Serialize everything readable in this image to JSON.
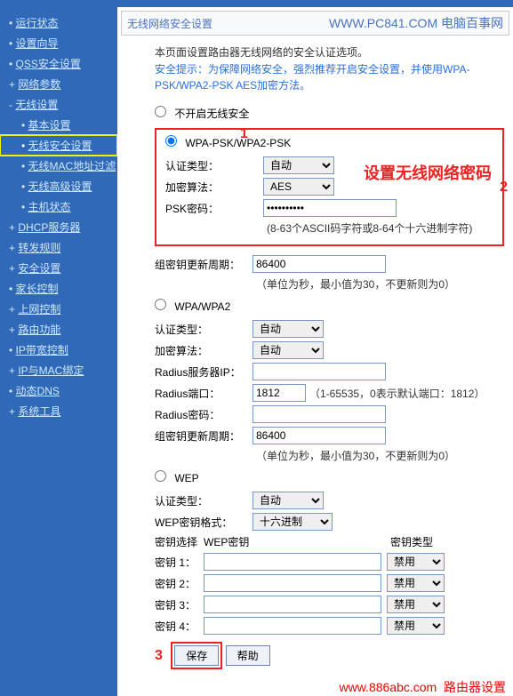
{
  "header": {
    "title": "无线网络安全设置",
    "brand": "WWW.PC841.COM 电脑百事网"
  },
  "sidebar": {
    "items": [
      "运行状态",
      "设置向导",
      "QSS安全设置",
      "网络参数",
      "无线设置"
    ],
    "wireless_sub": [
      "基本设置",
      "无线安全设置",
      "无线MAC地址过滤",
      "无线高级设置",
      "主机状态"
    ],
    "items2": [
      "DHCP服务器",
      "转发规则",
      "安全设置",
      "家长控制",
      "上网控制",
      "路由功能",
      "IP带宽控制",
      "IP与MAC绑定",
      "动态DNS",
      "系统工具"
    ]
  },
  "content": {
    "intro": "本页面设置路由器无线网络的安全认证选项。",
    "tip_prefix": "安全提示：",
    "tip_body": "为保障网络安全，强烈推荐开启安全设置，并使用WPA-PSK/WPA2-PSK AES加密方法。",
    "opt_none": "不开启无线安全",
    "wpa_psk": {
      "title": "WPA-PSK/WPA2-PSK",
      "auth_label": "认证类型：",
      "auth_value": "自动",
      "enc_label": "加密算法：",
      "enc_value": "AES",
      "psk_label": "PSK密码：",
      "psk_value": "●●●●●●●●●●",
      "psk_hint": "(8-63个ASCII码字符或8-64个十六进制字符)",
      "annotation": "设置无线网络密码"
    },
    "gk": {
      "label": "组密钥更新周期：",
      "value": "86400",
      "hint": "（单位为秒，最小值为30，不更新则为0）"
    },
    "wpa": {
      "title": "WPA/WPA2",
      "auth_label": "认证类型：",
      "auth_value": "自动",
      "enc_label": "加密算法：",
      "enc_value": "自动",
      "radius_ip_label": "Radius服务器IP：",
      "radius_ip_value": "",
      "radius_port_label": "Radius端口：",
      "radius_port_value": "1812",
      "radius_port_hint": "（1-65535，0表示默认端口：1812）",
      "radius_pw_label": "Radius密码：",
      "radius_pw_value": "",
      "gk_value": "86400"
    },
    "wep": {
      "title": "WEP",
      "auth_label": "认证类型：",
      "auth_value": "自动",
      "fmt_label": "WEP密钥格式：",
      "fmt_value": "十六进制",
      "sel_label": "密钥选择",
      "key_col": "WEP密钥",
      "type_col": "密钥类型",
      "keys": [
        {
          "label": "密钥 1：",
          "val": "",
          "type": "禁用"
        },
        {
          "label": "密钥 2：",
          "val": "",
          "type": "禁用"
        },
        {
          "label": "密钥 3：",
          "val": "",
          "type": "禁用"
        },
        {
          "label": "密钥 4：",
          "val": "",
          "type": "禁用"
        }
      ]
    },
    "buttons": {
      "save": "保存",
      "help": "帮助"
    }
  },
  "markers": {
    "m1": "1",
    "m2": "2",
    "m3": "3"
  },
  "footer": {
    "site": "www.886abc.com",
    "text": "路由器设置"
  }
}
